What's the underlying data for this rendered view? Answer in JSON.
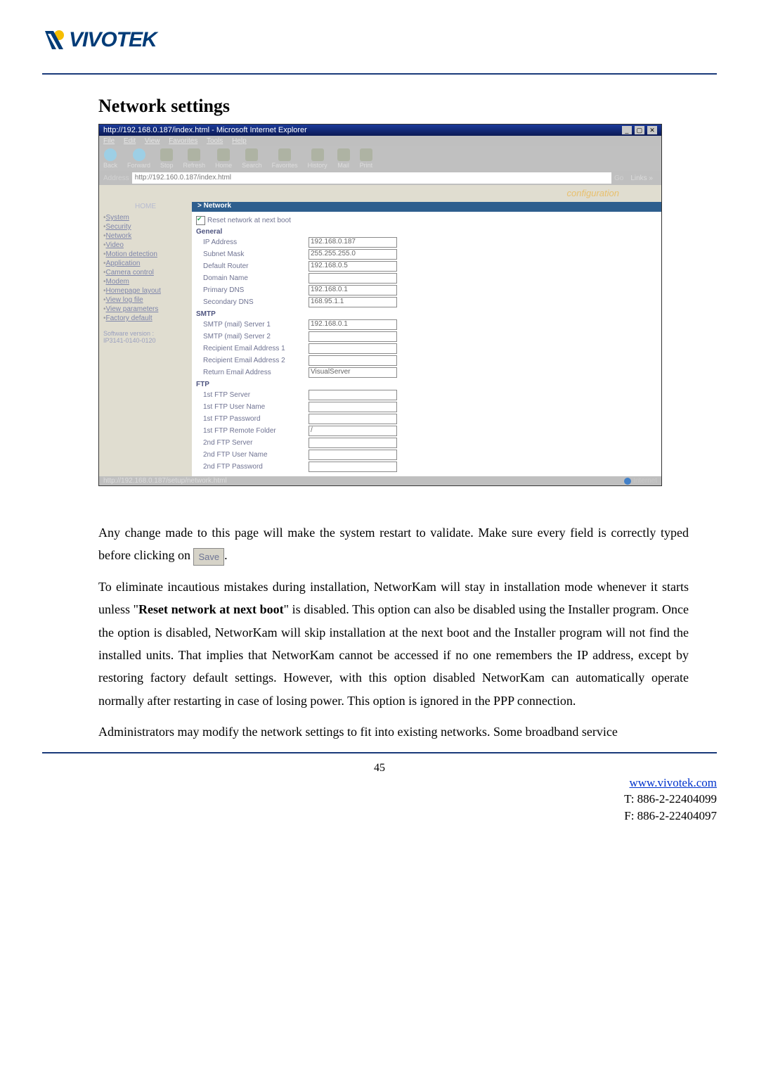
{
  "brand": "VIVOTEK",
  "heading": "Network settings",
  "browser": {
    "title": "http://192.168.0.187/index.html - Microsoft Internet Explorer",
    "menus": [
      "File",
      "Edit",
      "View",
      "Favorites",
      "Tools",
      "Help"
    ],
    "toolbar": [
      "Back",
      "Forward",
      "Stop",
      "Refresh",
      "Home",
      "Search",
      "Favorites",
      "History",
      "Mail",
      "Print"
    ],
    "address_label": "Address",
    "address_value": "http://192.160.0.187/index.html",
    "go": "Go",
    "links": "Links »",
    "status_url": "http://192.168.0.187/setup/network.html",
    "status_zone": "Internet"
  },
  "sidebar": {
    "home": "HOME",
    "items": [
      "System",
      "Security",
      "Network",
      "Video",
      "Motion detection",
      "Application",
      "Camera control",
      "Modem",
      "Homepage layout",
      "View log file",
      "View parameters",
      "Factory default"
    ],
    "version_label": "Software version :",
    "version_value": "IP3141-0140-0120"
  },
  "config_label": "configuration",
  "panel_heading": "> Network",
  "reset_label": "Reset network at next boot",
  "groups": {
    "general": "General",
    "smtp": "SMTP",
    "ftp": "FTP"
  },
  "fields": {
    "ip": {
      "label": "IP Address",
      "value": "192.168.0.187"
    },
    "mask": {
      "label": "Subnet Mask",
      "value": "255.255.255.0"
    },
    "router": {
      "label": "Default Router",
      "value": "192.168.0.5"
    },
    "domain": {
      "label": "Domain Name",
      "value": ""
    },
    "dns1": {
      "label": "Primary DNS",
      "value": "192.168.0.1"
    },
    "dns2": {
      "label": "Secondary DNS",
      "value": "168.95.1.1"
    },
    "smtp1": {
      "label": "SMTP (mail) Server 1",
      "value": "192.168.0.1"
    },
    "smtp2": {
      "label": "SMTP (mail) Server 2",
      "value": ""
    },
    "rcpt1": {
      "label": "Recipient Email Address 1",
      "value": ""
    },
    "rcpt2": {
      "label": "Recipient Email Address 2",
      "value": ""
    },
    "ret": {
      "label": "Return Email Address",
      "value": "VisualServer"
    },
    "ftp1": {
      "label": "1st FTP Server",
      "value": ""
    },
    "ftpu1": {
      "label": "1st FTP User Name",
      "value": ""
    },
    "ftpp1": {
      "label": "1st FTP Password",
      "value": ""
    },
    "ftpf1": {
      "label": "1st FTP Remote Folder",
      "value": "/"
    },
    "ftp2": {
      "label": "2nd FTP Server",
      "value": ""
    },
    "ftpu2": {
      "label": "2nd FTP User Name",
      "value": ""
    },
    "ftpp2": {
      "label": "2nd FTP Password",
      "value": ""
    }
  },
  "body": {
    "p1a": "Any change made to this page will make the system restart to validate. Make sure every field is correctly typed before clicking on ",
    "save": "Save",
    "p1b": ".",
    "p2a": "To eliminate incautious mistakes during installation, NetworKam will stay in installation mode whenever it starts unless \"",
    "p2bold": "Reset network at next boot",
    "p2b": "\" is disabled. This option can also be disabled using the Installer program. Once the option is disabled, NetworKam will skip installation at the next boot and the Installer program will not find the installed units. That implies that NetworKam cannot be accessed if no one remembers the IP address, except by restoring factory default settings. However, with this option disabled NetworKam can automatically operate normally after restarting in case of losing power. This option is ignored in the PPP connection.",
    "p3": "Administrators may modify the network settings to fit into existing networks. Some broadband service"
  },
  "page_number": "45",
  "footer": {
    "url": "www.vivotek.com",
    "tel": "T: 886-2-22404099",
    "fax": "F: 886-2-22404097"
  }
}
